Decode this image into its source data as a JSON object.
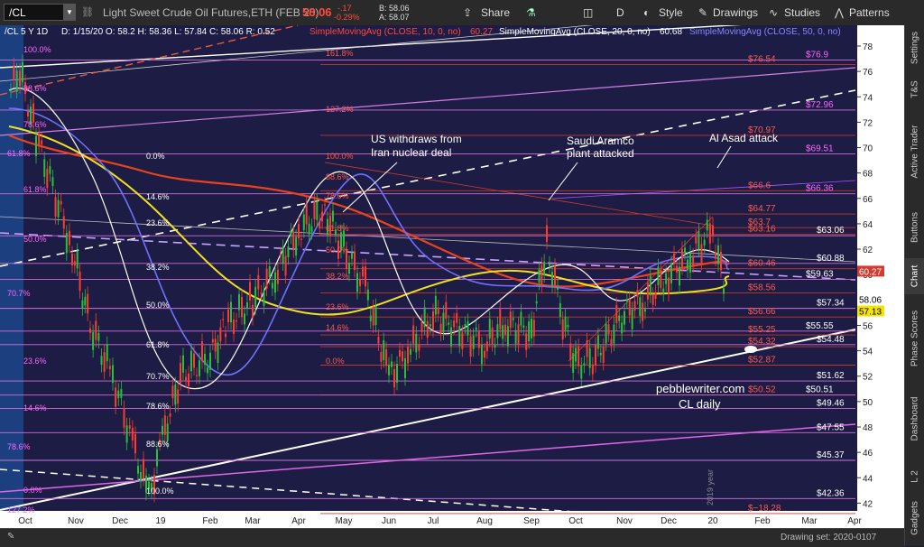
{
  "toolbar": {
    "symbol": "/CL",
    "description": "Light Sweet Crude Oil Futures,ETH (FEB 20)",
    "last_price": "58.06",
    "change": "-.17",
    "change_pct": "-0.29%",
    "bid": "B: 58.06",
    "ask": "A: 58.07",
    "share_label": "Share",
    "period": "D",
    "style_label": "Style",
    "drawings_label": "Drawings",
    "studies_label": "Studies",
    "patterns_label": "Patterns"
  },
  "legend": {
    "header": "/CL 5 Y 1D",
    "ohlc": "D: 1/15/20  O: 58.2  H: 58.36  L: 57.84  C: 58.06  R: 0.52",
    "sma10": "SimpleMovingAvg (CLOSE, 10, 0, no)",
    "sma10_value": "60.27",
    "sma20": "SimpleMovingAvg (CLOSE, 20, 0, no)",
    "sma20_value": "60.68",
    "sma50": "SimpleMovingAvg (CLOSE, 50, 0, no)"
  },
  "sidebar": {
    "tabs": [
      "Settings",
      "T&S",
      "Active Trader",
      "Buttons",
      "Chart",
      "Phase Scores",
      "Dashboard",
      "L 2",
      "Gadgets"
    ],
    "active_tab": "Chart"
  },
  "bottombar": {
    "drawing_set": "Drawing set: 2020-0107"
  },
  "annotations": {
    "us_iran": [
      "US withdraws from",
      "Iran nuclear deal"
    ],
    "aramco": [
      "Saudi Aramco",
      "plant attacked"
    ],
    "al_asad": "Al Asad attack",
    "watermark1": "pebblewriter.com",
    "watermark2": "CL daily",
    "year_marker": "2019 year"
  },
  "chart_data": {
    "type": "candlestick",
    "title": "Light Sweet Crude Oil Futures,ETH (FEB 20)",
    "xlabel": "",
    "ylabel": "",
    "x_ticks": [
      "Oct",
      "Nov",
      "Dec",
      "19",
      "Feb",
      "Mar",
      "Apr",
      "May",
      "Jun",
      "Jul",
      "Aug",
      "Sep",
      "Oct",
      "Nov",
      "Dec",
      "20",
      "Feb",
      "Mar",
      "Apr"
    ],
    "y_ticks": [
      42,
      44,
      46,
      48,
      50,
      52,
      54,
      56,
      58,
      60,
      62,
      64,
      66,
      68,
      70,
      72,
      74,
      76,
      78
    ],
    "ylim": [
      41,
      79
    ],
    "grid": false,
    "series": [
      {
        "name": "SimpleMovingAvg (CLOSE, 10, 0, no)",
        "color": "#e74c3c",
        "last": 60.27
      },
      {
        "name": "SimpleMovingAvg (CLOSE, 20, 0, no)",
        "color": "#ffffff",
        "last": 60.68
      },
      {
        "name": "SimpleMovingAvg (CLOSE, 50, 0, no)",
        "color": "#8080ff"
      }
    ],
    "close_path": [
      [
        "Oct",
        74.5
      ],
      [
        "Oct",
        76.0
      ],
      [
        "Oct",
        71.0
      ],
      [
        "Nov",
        62.0
      ],
      [
        "Nov",
        56.0
      ],
      [
        "Dec",
        52.0
      ],
      [
        "Dec",
        46.0
      ],
      [
        "Dec",
        42.5
      ],
      [
        "19",
        47.0
      ],
      [
        "19",
        52.0
      ],
      [
        "Feb",
        53.5
      ],
      [
        "Feb",
        56.0
      ],
      [
        "Mar",
        58.0
      ],
      [
        "Mar",
        60.0
      ],
      [
        "Apr",
        63.5
      ],
      [
        "Apr",
        65.0
      ],
      [
        "May",
        62.0
      ],
      [
        "May",
        59.0
      ],
      [
        "Jun",
        52.0
      ],
      [
        "Jun",
        54.0
      ],
      [
        "Jul",
        57.0
      ],
      [
        "Jul",
        56.0
      ],
      [
        "Aug",
        54.5
      ],
      [
        "Aug",
        56.0
      ],
      [
        "Sep",
        55.5
      ],
      [
        "Sep",
        62.5
      ],
      [
        "Sep",
        58.0
      ],
      [
        "Oct",
        53.0
      ],
      [
        "Oct",
        53.5
      ],
      [
        "Nov",
        57.0
      ],
      [
        "Nov",
        58.0
      ],
      [
        "Dec",
        60.0
      ],
      [
        "Dec",
        61.5
      ],
      [
        "20",
        63.5
      ],
      [
        "20",
        58.06
      ]
    ],
    "horizontal_levels": [
      {
        "value": 76.9,
        "label": "$76.9"
      },
      {
        "value": 76.54,
        "label": "$76.54"
      },
      {
        "value": 72.96,
        "label": "$72.96"
      },
      {
        "value": 70.97,
        "label": "$70.97"
      },
      {
        "value": 69.51,
        "label": "$69.51"
      },
      {
        "value": 66.6,
        "label": "$66.6"
      },
      {
        "value": 66.36,
        "label": "$66.36"
      },
      {
        "value": 64.77,
        "label": "$64.77"
      },
      {
        "value": 63.7,
        "label": "$63.7"
      },
      {
        "value": 63.16,
        "label": "$63.16"
      },
      {
        "value": 63.06,
        "label": "$63.06"
      },
      {
        "value": 60.88,
        "label": "$60.88"
      },
      {
        "value": 60.46,
        "label": "$60.46"
      },
      {
        "value": 59.63,
        "label": "$59.63"
      },
      {
        "value": 58.56,
        "label": "$58.56"
      },
      {
        "value": 57.34,
        "label": "$57.34"
      },
      {
        "value": 56.66,
        "label": "$56.66"
      },
      {
        "value": 55.55,
        "label": "$55.55"
      },
      {
        "value": 55.25,
        "label": "$55.25"
      },
      {
        "value": 54.48,
        "label": "$54.48"
      },
      {
        "value": 54.32,
        "label": "$54.32"
      },
      {
        "value": 52.87,
        "label": "$52.87"
      },
      {
        "value": 51.62,
        "label": "$51.62"
      },
      {
        "value": 50.52,
        "label": "$50.52"
      },
      {
        "value": 50.51,
        "label": "$50.51"
      },
      {
        "value": 49.46,
        "label": "$49.46"
      },
      {
        "value": 47.55,
        "label": "$47.55"
      },
      {
        "value": 45.37,
        "label": "$45.37"
      },
      {
        "value": 42.36,
        "label": "$42.36"
      },
      {
        "value": 41.18,
        "label": "$~18.28"
      }
    ],
    "price_tags": [
      {
        "value": 60.27,
        "label": "60.27",
        "color": "#d23b2f"
      },
      {
        "value": 58.06,
        "label": "58.06",
        "color": "#ffffff"
      },
      {
        "value": 57.13,
        "label": "57.13",
        "color": "#f5e400"
      }
    ],
    "fib_left_labels": [
      "100.0%",
      "88.6%",
      "78.6%",
      "61.8%",
      "61.8%",
      "50.0%",
      "38.2%",
      "70.7%",
      "23.6%",
      "14.6%",
      "78.6%",
      "0.0%",
      "127.2%"
    ],
    "fib_mid_labels": [
      "0.0%",
      "14.6%",
      "23.6%",
      "38.2%",
      "50.0%",
      "61.8%",
      "70.7%",
      "78.6%",
      "88.6%",
      "100.0%"
    ],
    "fib_red_labels": [
      "161.8%",
      "127.2%",
      "100.0%",
      "88.6%",
      "78.6%",
      "61.8%",
      "50.0%",
      "38.2%",
      "23.6%",
      "14.6%",
      "0.0%"
    ]
  }
}
